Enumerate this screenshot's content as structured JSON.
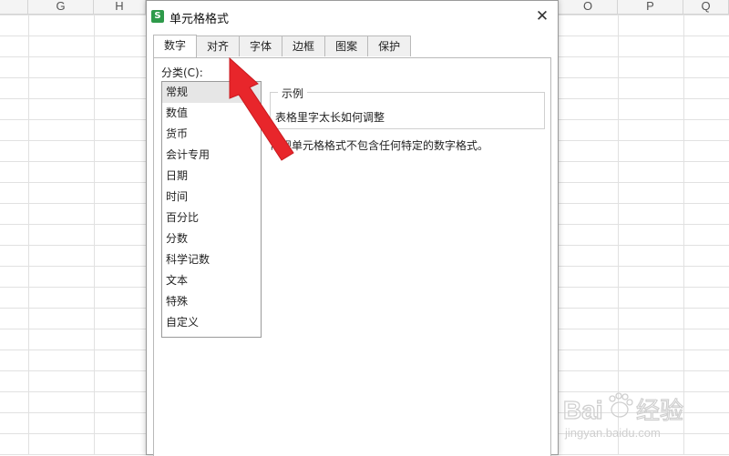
{
  "sheet": {
    "columns_left": [
      "G",
      "H"
    ],
    "columns_right": [
      "O",
      "P",
      "Q"
    ]
  },
  "dialog": {
    "app_logo": "S",
    "title": "单元格格式",
    "close_glyph": "✕",
    "tabs": [
      {
        "label": "数字",
        "active": true
      },
      {
        "label": "对齐",
        "active": false
      },
      {
        "label": "字体",
        "active": false
      },
      {
        "label": "边框",
        "active": false
      },
      {
        "label": "图案",
        "active": false
      },
      {
        "label": "保护",
        "active": false
      }
    ],
    "category_label": "分类(C):",
    "categories": [
      "常规",
      "数值",
      "货币",
      "会计专用",
      "日期",
      "时间",
      "百分比",
      "分数",
      "科学记数",
      "文本",
      "特殊",
      "自定义"
    ],
    "selected_category": "常规",
    "sample": {
      "legend": "示例",
      "value": "表格里字太长如何调整"
    },
    "description": "常规单元格格式不包含任何特定的数字格式。"
  },
  "annotation": {
    "arrow_color": "#e8262b",
    "points_to": "对齐"
  },
  "watermark": {
    "logo_text": "Bai",
    "brand_cn": "经验",
    "url": "jingyan.baidu.com"
  }
}
